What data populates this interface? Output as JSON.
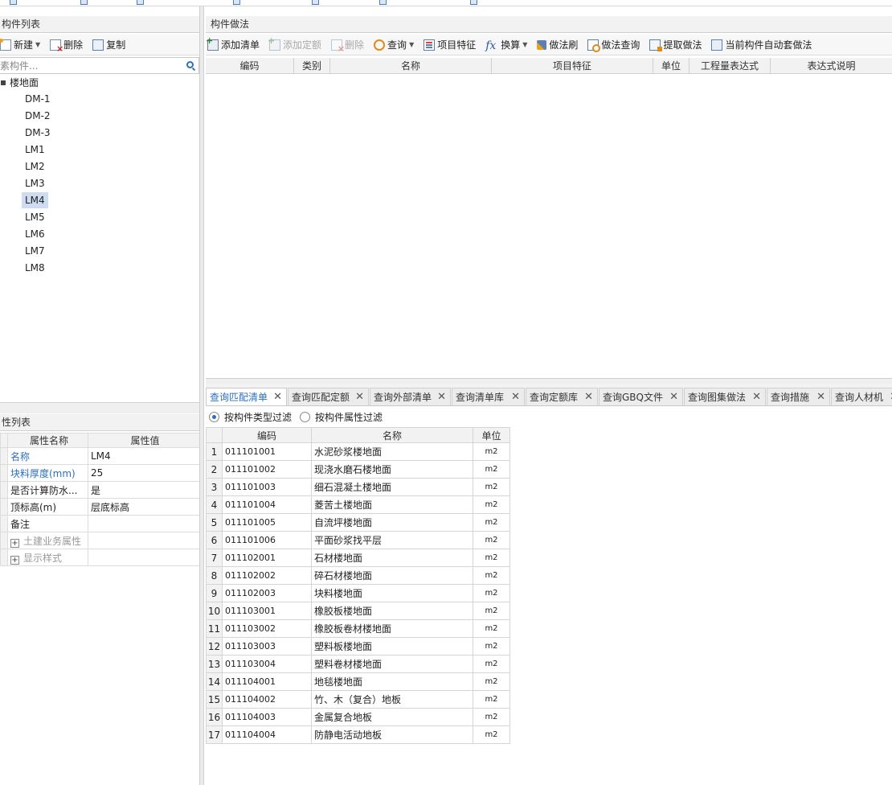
{
  "left_panel": {
    "title": "构件列表",
    "toolbar": {
      "new": "新建",
      "delete": "删除",
      "copy": "复制"
    },
    "search_placeholder": "素构件...",
    "tree": {
      "root": "楼地面",
      "items": [
        "DM-1",
        "DM-2",
        "DM-3",
        "LM1",
        "LM2",
        "LM3",
        "LM4",
        "LM5",
        "LM6",
        "LM7",
        "LM8"
      ],
      "selected": "LM4"
    }
  },
  "properties": {
    "title": "性列表",
    "headers": {
      "name": "属性名称",
      "value": "属性值"
    },
    "rows": [
      {
        "name": "名称",
        "value": "LM4"
      },
      {
        "name": "块料厚度(mm)",
        "value": "25"
      },
      {
        "name": "是否计算防水...",
        "value": "是"
      },
      {
        "name": "顶标高(m)",
        "value": "层底标高"
      },
      {
        "name": "备注",
        "value": ""
      },
      {
        "name": "土建业务属性",
        "value": ""
      },
      {
        "name": "显示样式",
        "value": ""
      }
    ]
  },
  "method_panel": {
    "title": "构件做法",
    "toolbar": {
      "add_list": "添加清单",
      "add_quota": "添加定额",
      "delete": "删除",
      "query": "查询",
      "item_feature": "项目特征",
      "convert": "换算",
      "method_brush": "做法刷",
      "method_query": "做法查询",
      "extract_method": "提取做法",
      "auto_method": "当前构件自动套做法"
    },
    "columns": [
      "编码",
      "类别",
      "名称",
      "项目特征",
      "单位",
      "工程量表达式",
      "表达式说明"
    ]
  },
  "query_tabs": {
    "tabs": [
      "查询匹配清单",
      "查询匹配定额",
      "查询外部清单",
      "查询清单库",
      "查询定额库",
      "查询GBQ文件",
      "查询图集做法",
      "查询措施",
      "查询人材机"
    ],
    "active": "查询匹配清单"
  },
  "filters": {
    "by_type": "按构件类型过滤",
    "by_attr": "按构件属性过滤",
    "selected": "by_type"
  },
  "results": {
    "headers": {
      "code": "编码",
      "name": "名称",
      "unit": "单位"
    },
    "rows": [
      {
        "no": "1",
        "code": "011101001",
        "name": "水泥砂浆楼地面",
        "unit": "m2"
      },
      {
        "no": "2",
        "code": "011101002",
        "name": "现浇水磨石楼地面",
        "unit": "m2"
      },
      {
        "no": "3",
        "code": "011101003",
        "name": "细石混凝土楼地面",
        "unit": "m2"
      },
      {
        "no": "4",
        "code": "011101004",
        "name": "菱苦土楼地面",
        "unit": "m2"
      },
      {
        "no": "5",
        "code": "011101005",
        "name": "自流坪楼地面",
        "unit": "m2"
      },
      {
        "no": "6",
        "code": "011101006",
        "name": "平面砂浆找平层",
        "unit": "m2"
      },
      {
        "no": "7",
        "code": "011102001",
        "name": "石材楼地面",
        "unit": "m2"
      },
      {
        "no": "8",
        "code": "011102002",
        "name": "碎石材楼地面",
        "unit": "m2"
      },
      {
        "no": "9",
        "code": "011102003",
        "name": "块料楼地面",
        "unit": "m2"
      },
      {
        "no": "10",
        "code": "011103001",
        "name": "橡胶板楼地面",
        "unit": "m2"
      },
      {
        "no": "11",
        "code": "011103002",
        "name": "橡胶板卷材楼地面",
        "unit": "m2"
      },
      {
        "no": "12",
        "code": "011103003",
        "name": "塑料板楼地面",
        "unit": "m2"
      },
      {
        "no": "13",
        "code": "011103004",
        "name": "塑料卷材楼地面",
        "unit": "m2"
      },
      {
        "no": "14",
        "code": "011104001",
        "name": "地毯楼地面",
        "unit": "m2"
      },
      {
        "no": "15",
        "code": "011104002",
        "name": "竹、木（复合）地板",
        "unit": "m2"
      },
      {
        "no": "16",
        "code": "011104003",
        "name": "金属复合地板",
        "unit": "m2"
      },
      {
        "no": "17",
        "code": "011104004",
        "name": "防静电活动地板",
        "unit": "m2"
      }
    ]
  },
  "colors": {
    "accent": "#2b6fc0",
    "selection": "#cddcf0",
    "header_bg": "#f2f2f2"
  }
}
